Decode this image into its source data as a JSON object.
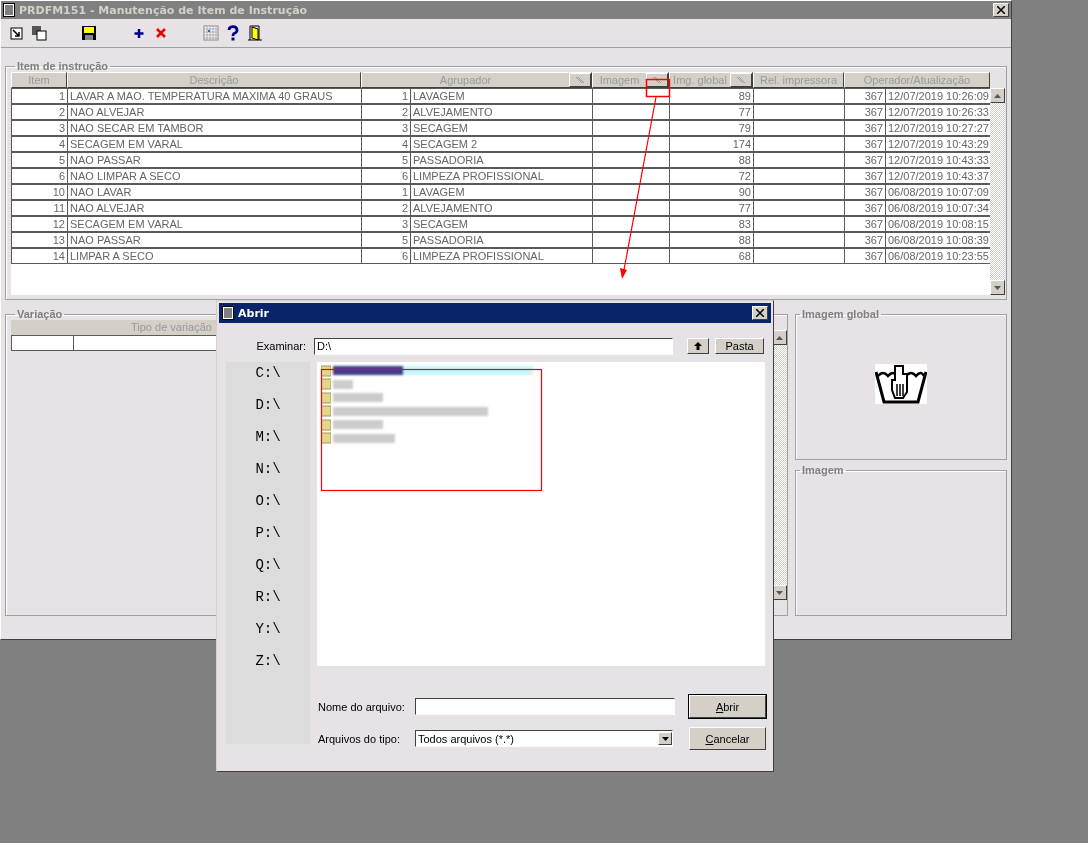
{
  "window": {
    "title": "PRDFM151 - Manutenção de Item de Instrução"
  },
  "item_group": {
    "title": "Item de instrução",
    "columns": [
      {
        "label": "Item",
        "sort_button": false
      },
      {
        "label": "Descrição",
        "sort_button": false
      },
      {
        "label": "Agrupador",
        "sort_button": true
      },
      {
        "label": "Imagem",
        "sort_button": true
      },
      {
        "label": "Img. global",
        "sort_button": true
      },
      {
        "label": "Rel. impressora",
        "sort_button": false
      },
      {
        "label": "Operador/Atualização",
        "sort_button": false
      }
    ],
    "rows": [
      {
        "item": "1",
        "description": "LAVAR A MAO. TEMPERATURA MAXIMA 40 GRAUS",
        "group_code": "1",
        "group_name": "LAVAGEM",
        "global_image": "89",
        "operator": "367",
        "updated": "12/07/2019 10:26:09"
      },
      {
        "item": "2",
        "description": "NAO ALVEJAR",
        "group_code": "2",
        "group_name": "ALVEJAMENTO",
        "global_image": "77",
        "operator": "367",
        "updated": "12/07/2019 10:26:33"
      },
      {
        "item": "3",
        "description": "NAO SECAR EM TAMBOR",
        "group_code": "3",
        "group_name": "SECAGEM",
        "global_image": "79",
        "operator": "367",
        "updated": "12/07/2019 10:27:27"
      },
      {
        "item": "4",
        "description": "SECAGEM EM VARAL",
        "group_code": "4",
        "group_name": "SECAGEM 2",
        "global_image": "174",
        "operator": "367",
        "updated": "12/07/2019 10:43:29"
      },
      {
        "item": "5",
        "description": "NAO PASSAR",
        "group_code": "5",
        "group_name": "PASSADORIA",
        "global_image": "88",
        "operator": "367",
        "updated": "12/07/2019 10:43:33"
      },
      {
        "item": "6",
        "description": "NAO LIMPAR A SECO",
        "group_code": "6",
        "group_name": "LIMPEZA PROFISSIONAL",
        "global_image": "72",
        "operator": "367",
        "updated": "12/07/2019 10:43:37"
      },
      {
        "item": "10",
        "description": "NAO LAVAR",
        "group_code": "1",
        "group_name": "LAVAGEM",
        "global_image": "90",
        "operator": "367",
        "updated": "06/08/2019 10:07:09"
      },
      {
        "item": "11",
        "description": "NAO ALVEJAR",
        "group_code": "2",
        "group_name": "ALVEJAMENTO",
        "global_image": "77",
        "operator": "367",
        "updated": "06/08/2019 10:07:34"
      },
      {
        "item": "12",
        "description": "SECAGEM EM VARAL",
        "group_code": "3",
        "group_name": "SECAGEM",
        "global_image": "83",
        "operator": "367",
        "updated": "06/08/2019 10:08:15"
      },
      {
        "item": "13",
        "description": "NAO PASSAR",
        "group_code": "5",
        "group_name": "PASSADORIA",
        "global_image": "88",
        "operator": "367",
        "updated": "06/08/2019 10:08:39"
      },
      {
        "item": "14",
        "description": "LIMPAR A SECO",
        "group_code": "6",
        "group_name": "LIMPEZA PROFISSIONAL",
        "global_image": "68",
        "operator": "367",
        "updated": "06/08/2019 10:23:55"
      }
    ]
  },
  "variation_group": {
    "title": "Variação",
    "columns": [
      "Tipo de variação"
    ]
  },
  "global_image_group": {
    "title": "Imagem global"
  },
  "image_group": {
    "title": "Imagem"
  },
  "dialog": {
    "title": "Abrir",
    "look_in_label": "Examinar:",
    "look_in_value": "D:\\",
    "folder_button": "Pasta",
    "drives": [
      "C:\\",
      "D:\\",
      "M:\\",
      "N:\\",
      "O:\\",
      "P:\\",
      "Q:\\",
      "R:\\",
      "Y:\\",
      "Z:\\"
    ],
    "folders": [
      {
        "selected": true
      },
      {
        "selected": false
      },
      {
        "selected": false
      },
      {
        "selected": false
      },
      {
        "selected": false
      },
      {
        "selected": false
      }
    ],
    "file_name_label": "Nome do arquivo:",
    "file_type_label": "Arquivos do tipo:",
    "file_type_value": "Todos arquivos (*.*)",
    "open_button": "Abrir",
    "cancel_button": "Cancelar"
  }
}
